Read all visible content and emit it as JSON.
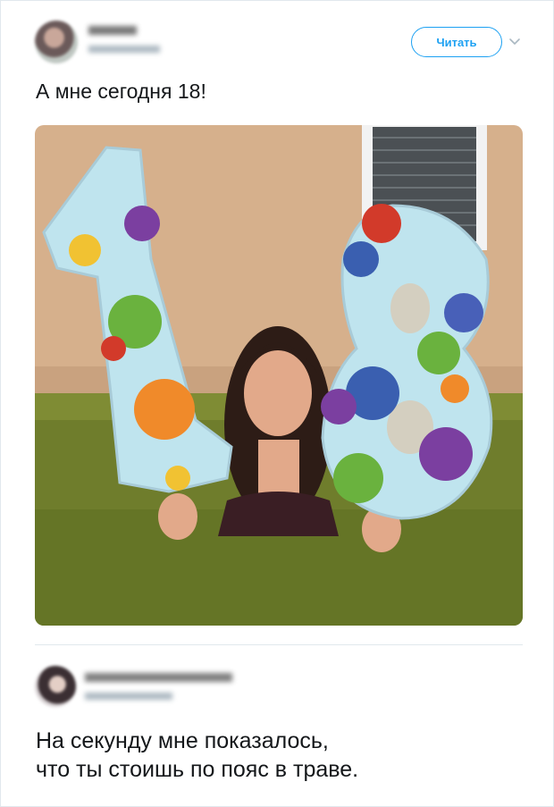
{
  "tweet": {
    "follow_label": "Читать",
    "text": "А мне сегодня 18!"
  },
  "reply": {
    "text_line1": "На секунду мне показалось,",
    "text_line2": "что ты стоишь по пояс в траве."
  },
  "icons": {
    "chevron": "chevron-down-icon"
  },
  "colors": {
    "accent": "#1da1f2",
    "divider": "#e1e8ed",
    "text": "#14171a"
  }
}
